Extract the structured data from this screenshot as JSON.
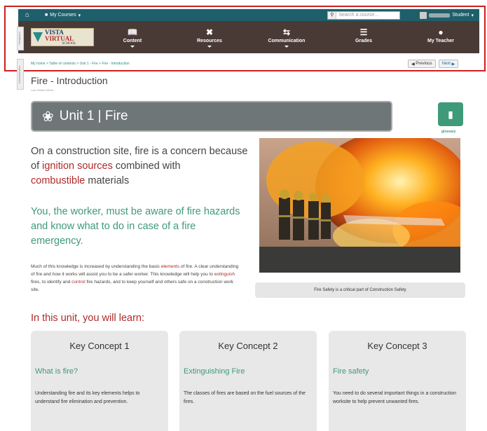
{
  "topbar": {
    "courses_label": "My Courses",
    "search_placeholder": "Search a course...",
    "user_role": "Student"
  },
  "brand": {
    "name_part1": "VISTA",
    "name_part2": "VIRTUAL",
    "subtitle": "SCHOOL"
  },
  "nav": {
    "items": [
      {
        "label": "Content",
        "icon": "book-icon"
      },
      {
        "label": "Resources",
        "icon": "tools-icon"
      },
      {
        "label": "Communication",
        "icon": "arrows-exchange-icon"
      },
      {
        "label": "Grades",
        "icon": "list-icon"
      },
      {
        "label": "My Teacher",
        "icon": "apple-icon"
      }
    ]
  },
  "side_tabs": {
    "navigation": "Navigation",
    "administration": "Administration"
  },
  "breadcrumb": "My home > Table of contents > Unit 1 - Fire > Fire - Introduction",
  "pager": {
    "previous": "Previous",
    "next": "Next"
  },
  "page": {
    "title": "Fire - Introduction",
    "last_visited": "Last Visited Never"
  },
  "banner": {
    "text": "Unit 1 | Fire"
  },
  "glossary": {
    "label": "glossary"
  },
  "intro": {
    "part1": "On a construction site, fire is a concern because of ",
    "highlight1": "ignition sources",
    "part2": " combined with ",
    "highlight2": "combustible",
    "part3": " materials"
  },
  "warning": "You, the worker, must be aware of fire hazards and know what to do in case of a fire emergency.",
  "body": {
    "part1": "Much of this knowledge is increased by understanding the basic ",
    "link1": "elements",
    "part2": " of fire. A clear understanding of fire and how it works will assist you to be a safer worker. This knowledge will help you to ",
    "link2": "extinguish",
    "part3": " fires, to identify and ",
    "link3": "control",
    "part4": " fire hazards, and to keep yourself and others safe on a construction work site."
  },
  "photo_caption": "Fire Safety is a critical part of Construction Safety",
  "learn_heading": "In this unit, you will learn:",
  "concepts": [
    {
      "title": "Key Concept 1",
      "subtitle": "What is fire?",
      "desc": "Understanding fire and its key elements helps to understand fire elimination and prevention."
    },
    {
      "title": "Key Concept 2",
      "subtitle": "Extinguishing Fire",
      "desc": "The classes of fires are based on the fuel sources of the fires."
    },
    {
      "title": "Key Concept 3",
      "subtitle": "Fire safety",
      "desc": "You need to do several important things in a construction worksite to help prevent unwanted fires."
    }
  ],
  "colors": {
    "topbar": "#1f5f6b",
    "navbar": "#4a3a35",
    "accent_green": "#3f9a7a",
    "accent_red": "#b02a2a",
    "highlight_box": "#cc1f1f"
  }
}
